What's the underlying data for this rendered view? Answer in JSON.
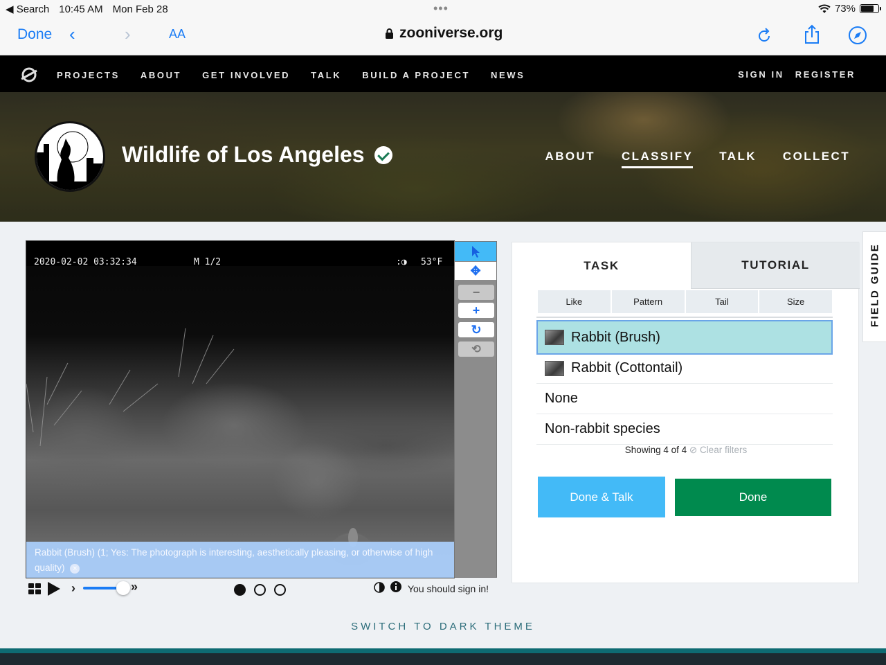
{
  "status_bar": {
    "back_app": "◀ Search",
    "time": "10:45 AM",
    "date": "Mon Feb 28",
    "battery": "73%",
    "battery_level": 0.73
  },
  "browser": {
    "done_label": "Done",
    "text_size_label": "AA",
    "url": "zooniverse.org"
  },
  "site_nav": {
    "links": [
      "PROJECTS",
      "ABOUT",
      "GET INVOLVED",
      "TALK",
      "BUILD A PROJECT",
      "NEWS"
    ],
    "sign_in": "SIGN IN",
    "register": "REGISTER"
  },
  "project": {
    "title": "Wildlife of Los Angeles",
    "nav": [
      "ABOUT",
      "CLASSIFY",
      "TALK",
      "COLLECT"
    ],
    "active_nav": "CLASSIFY"
  },
  "subject": {
    "timestamp": "2020-02-02 03:32:34",
    "frame": "M 1/2",
    "moon": ":◑",
    "temp": "53°F",
    "annotation": "Rabbit (Brush) (1; Yes: The photograph is interesting, aesthetically pleasing, or otherwise of high quality)",
    "annotation_close": "×"
  },
  "controls": {
    "sign_in_msg": "You should sign in!",
    "frame_dots": 3,
    "current_frame": 1
  },
  "task_panel": {
    "tab_task": "TASK",
    "tab_tutorial": "TUTORIAL",
    "filters": [
      "Like",
      "Pattern",
      "Tail",
      "Size"
    ],
    "choices": [
      "Rabbit (Brush)",
      "Rabbit (Cottontail)",
      "None",
      "Non-rabbit species"
    ],
    "selected_choice": "Rabbit (Brush)",
    "showing": "Showing 4 of 4",
    "clear_filters": "Clear filters",
    "done_talk": "Done & Talk",
    "done": "Done"
  },
  "field_guide": "FIELD GUIDE",
  "dark_theme": "SWITCH TO DARK THEME",
  "colors": {
    "accent_blue": "#43baf7",
    "done_green": "#008a4e",
    "selected_choice": "#ade1e3",
    "ios_blue": "#1a7cf5",
    "footer_teal": "#0e6b72"
  }
}
